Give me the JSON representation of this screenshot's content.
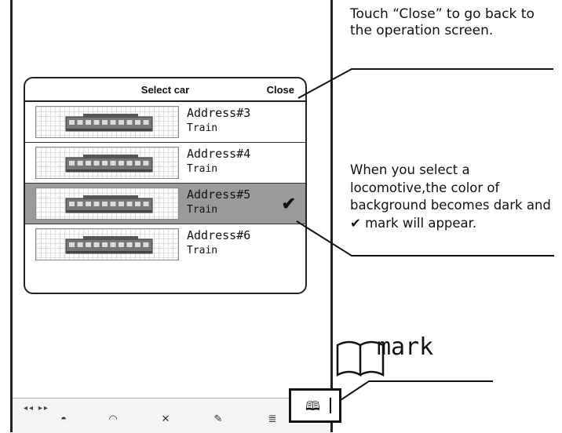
{
  "dialog": {
    "title": "Select car",
    "close_label": "Close"
  },
  "cars": [
    {
      "address": "Address#3",
      "type": "Train",
      "selected": false
    },
    {
      "address": "Address#4",
      "type": "Train",
      "selected": false
    },
    {
      "address": "Address#5",
      "type": "Train",
      "selected": true
    },
    {
      "address": "Address#6",
      "type": "Train",
      "selected": false
    }
  ],
  "selected_mark": "✔",
  "bottombar": {
    "arrows": "◂◂ ▸▸",
    "icons": [
      "speedometer-icon",
      "gauge-icon",
      "tools-icon",
      "edit-icon",
      "list-icon"
    ]
  },
  "book_icon": "🕮",
  "annotations": {
    "close_note": "Touch “Close” to go back to the operation screen.",
    "select_note": "When you select a locomotive,the color of background becomes dark and ✔ mark will appear.",
    "mark_label": "mark"
  },
  "colors": {
    "selected_row": "#9a9a9a",
    "border": "#222222"
  }
}
